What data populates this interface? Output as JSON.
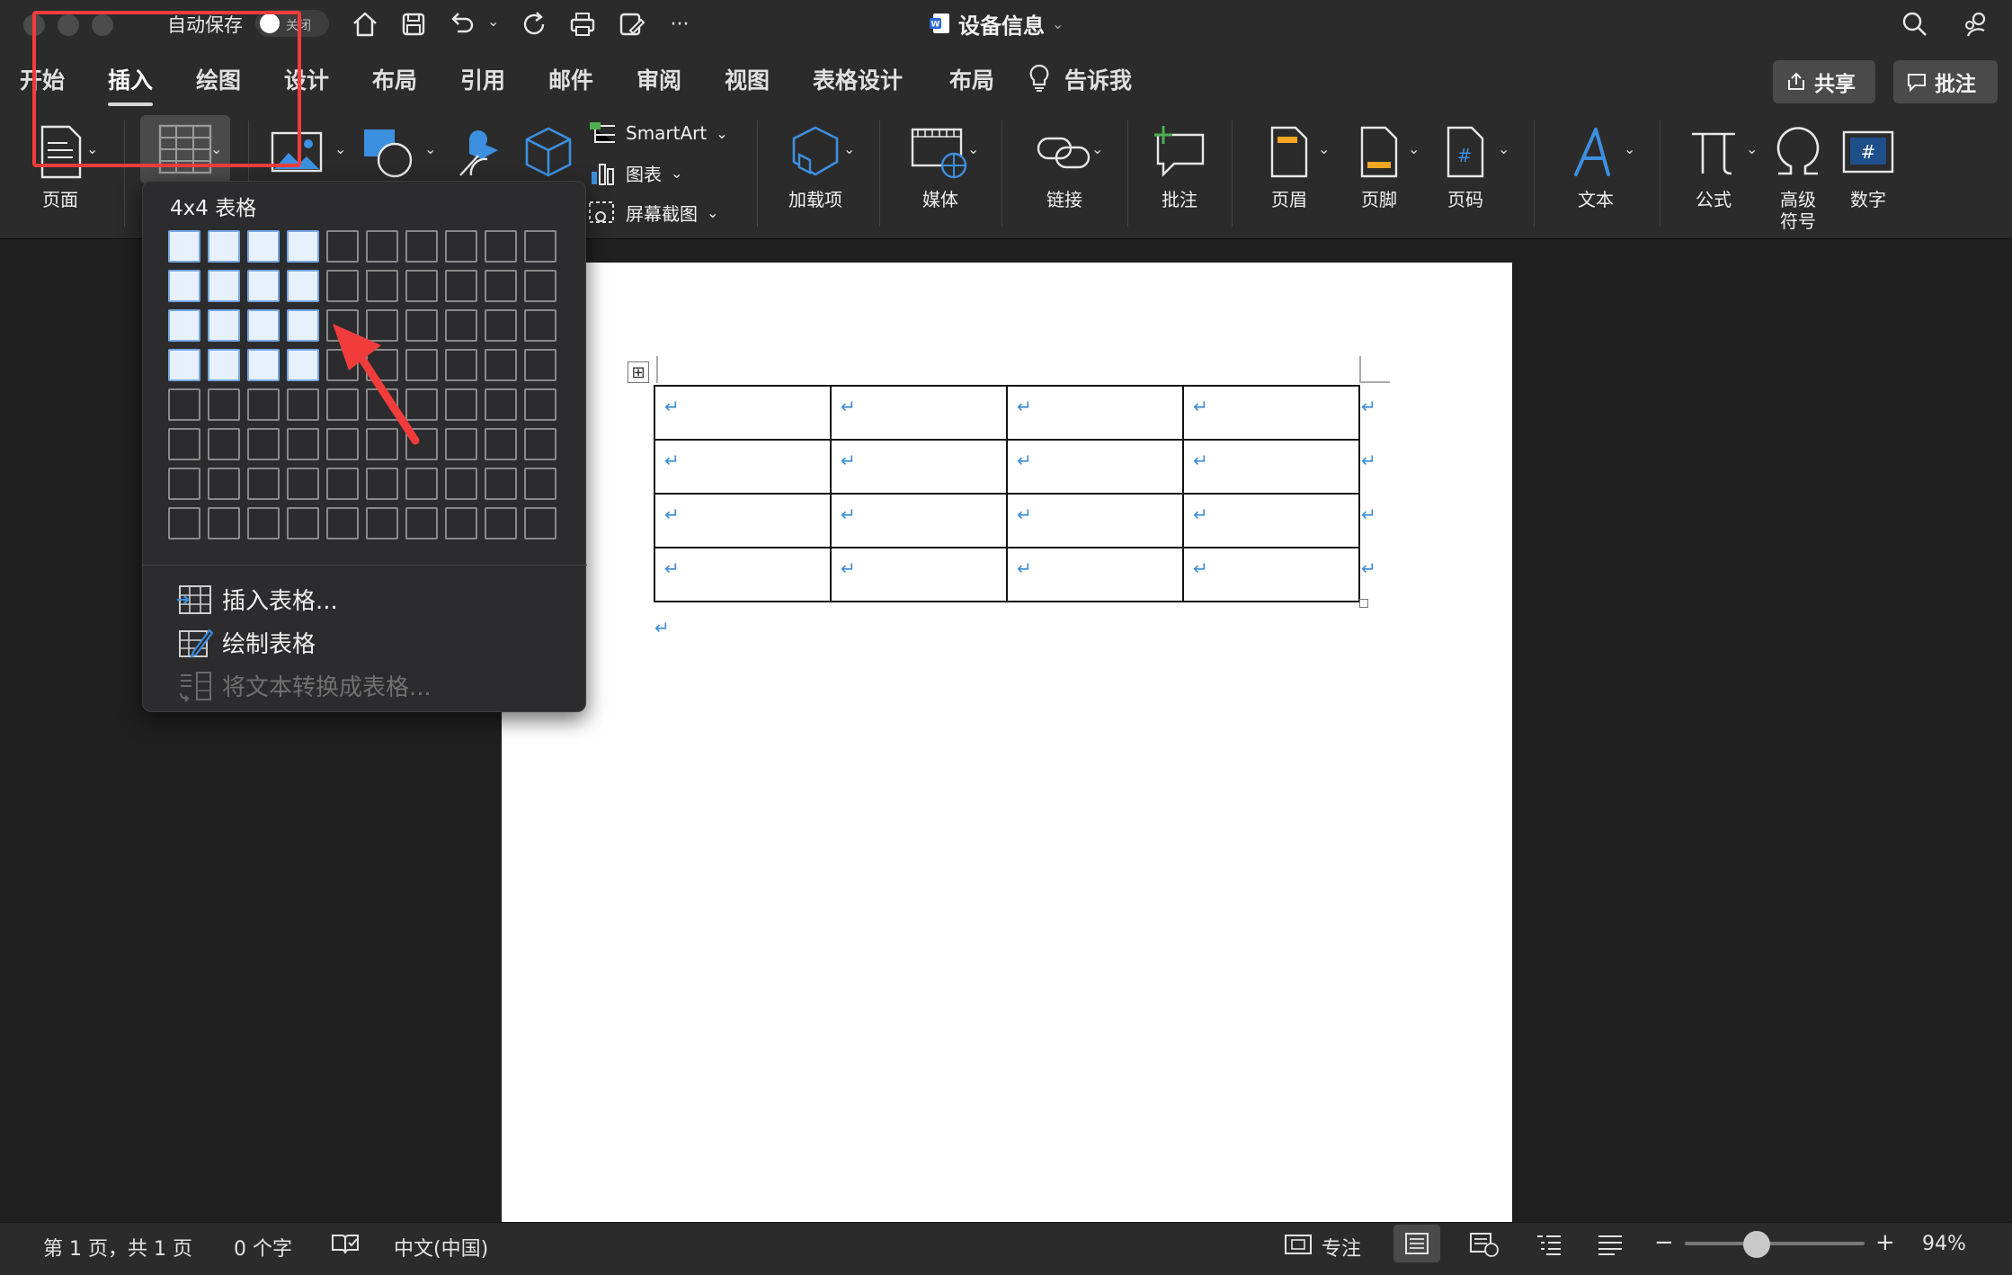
{
  "titlebar": {
    "autosave_label": "自动保存",
    "autosave_state": "关闭",
    "doc_title": "设备信息",
    "title_chevron": "⌄"
  },
  "quick_access": {
    "icons": [
      "home-icon",
      "save-icon",
      "undo-icon",
      "redo-icon",
      "print-icon",
      "save-as-icon",
      "more-icon"
    ],
    "more_label": "···",
    "undo_chevron": "⌄"
  },
  "tabs": {
    "items": [
      {
        "label": "开始"
      },
      {
        "label": "插入"
      },
      {
        "label": "绘图"
      },
      {
        "label": "设计"
      },
      {
        "label": "布局"
      },
      {
        "label": "引用"
      },
      {
        "label": "邮件"
      },
      {
        "label": "审阅"
      },
      {
        "label": "视图"
      },
      {
        "label": "表格设计"
      },
      {
        "label": "布局"
      },
      {
        "label": "告诉我"
      }
    ],
    "active": "插入"
  },
  "top_buttons": {
    "share_label": "共享",
    "comment_label": "批注"
  },
  "ribbon": {
    "pages": "页面",
    "smartart": "SmartArt",
    "chart": "图表",
    "screenshot": "屏幕截图",
    "addins": "加载项",
    "media": "媒体",
    "link": "链接",
    "comment": "批注",
    "header": "页眉",
    "footer": "页脚",
    "page_number": "页码",
    "text": "文本",
    "equation": "公式",
    "advanced_symbol": "高级符号",
    "number": "数字",
    "chevron": "⌄"
  },
  "table_dropdown": {
    "grid_title": "4x4 表格",
    "grid_columns": 10,
    "grid_rows": 8,
    "selected_columns": 4,
    "selected_rows": 4,
    "items": [
      {
        "label": "插入表格...",
        "enabled": true
      },
      {
        "label": "绘制表格",
        "enabled": true
      },
      {
        "label": "将文本转换成表格...",
        "enabled": false
      }
    ]
  },
  "document": {
    "table_rows": 4,
    "table_columns": 4,
    "paragraph_mark": "↵"
  },
  "statusbar": {
    "page_info": "第 1 页，共 1 页",
    "word_count": "0 个字",
    "language": "中文(中国)",
    "focus_label": "专注",
    "zoom_minus": "−",
    "zoom_plus": "+",
    "zoom_level": "94%",
    "zoom_fraction": 0.4
  },
  "colors": {
    "highlight_box": "#f23c3c",
    "annotation_arrow": "#f23c3c",
    "selected_cell": "#e7f1fd",
    "paragraph_mark": "#3e8ed6"
  }
}
